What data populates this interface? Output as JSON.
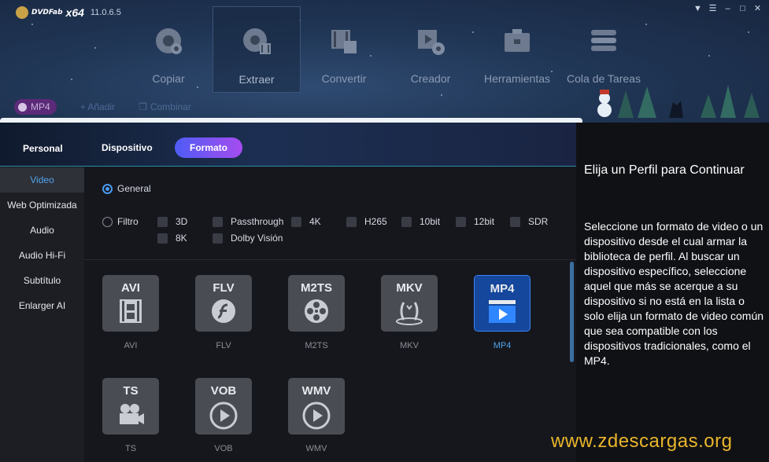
{
  "app": {
    "brand": "DVDFab",
    "edition": "x64",
    "version": "11.0.6.5"
  },
  "nav": [
    {
      "label": "Copiar",
      "icon": "disc-copy-icon"
    },
    {
      "label": "Extraer",
      "icon": "disc-ripper-icon"
    },
    {
      "label": "Convertir",
      "icon": "video-converter-icon"
    },
    {
      "label": "Creador",
      "icon": "disc-creator-icon"
    },
    {
      "label": "Herramientas",
      "icon": "toolbox-icon"
    },
    {
      "label": "Cola de Tareas",
      "icon": "task-queue-icon"
    }
  ],
  "toolbar": {
    "profile_chip": "MP4",
    "add_label": "+ Añadir",
    "merge_label": "Combinar"
  },
  "tabs": {
    "personal": "Personal",
    "device": "Dispositivo",
    "format": "Formato"
  },
  "sidebar": [
    {
      "label": "Video",
      "active": true
    },
    {
      "label": "Web Optimizada"
    },
    {
      "label": "Audio"
    },
    {
      "label": "Audio Hi-Fi"
    },
    {
      "label": "Subtítulo"
    },
    {
      "label": "Enlarger AI"
    }
  ],
  "filters": {
    "general": "General",
    "filter": "Filtro",
    "options": [
      "3D",
      "Passthrough",
      "4K",
      "H265",
      "10bit",
      "12bit",
      "SDR",
      "8K",
      "Dolby Visión"
    ]
  },
  "formats": [
    {
      "code": "AVI",
      "label": "AVI",
      "icon": "film-strip-icon"
    },
    {
      "code": "FLV",
      "label": "FLV",
      "icon": "flash-icon"
    },
    {
      "code": "M2TS",
      "label": "M2TS",
      "icon": "film-reel-icon"
    },
    {
      "code": "MKV",
      "label": "MKV",
      "icon": "matroska-icon"
    },
    {
      "code": "MP4",
      "label": "MP4",
      "icon": "play-screen-icon",
      "selected": true
    },
    {
      "code": "TS",
      "label": "TS",
      "icon": "video-camera-icon"
    },
    {
      "code": "VOB",
      "label": "VOB",
      "icon": "play-circle-icon"
    },
    {
      "code": "WMV",
      "label": "WMV",
      "icon": "play-circle-icon"
    }
  ],
  "info": {
    "title": "Elija un Perfil para Continuar",
    "body": "Seleccione un formato de video o un dispositivo desde el cual armar la biblioteca de perfil. Al buscar un dispositivo específico, seleccione aquel que más se acerque a su dispositivo si no está en la lista o solo elija un formato de video común que sea compatible con los dispositivos tradicionales, como el MP4."
  },
  "watermark": "www.zdescargas.org",
  "colors": {
    "accent": "#4a9bf0",
    "format_tab_from": "#4e5cf4",
    "format_tab_to": "#a64cf0",
    "watermark": "#e9b62b"
  }
}
